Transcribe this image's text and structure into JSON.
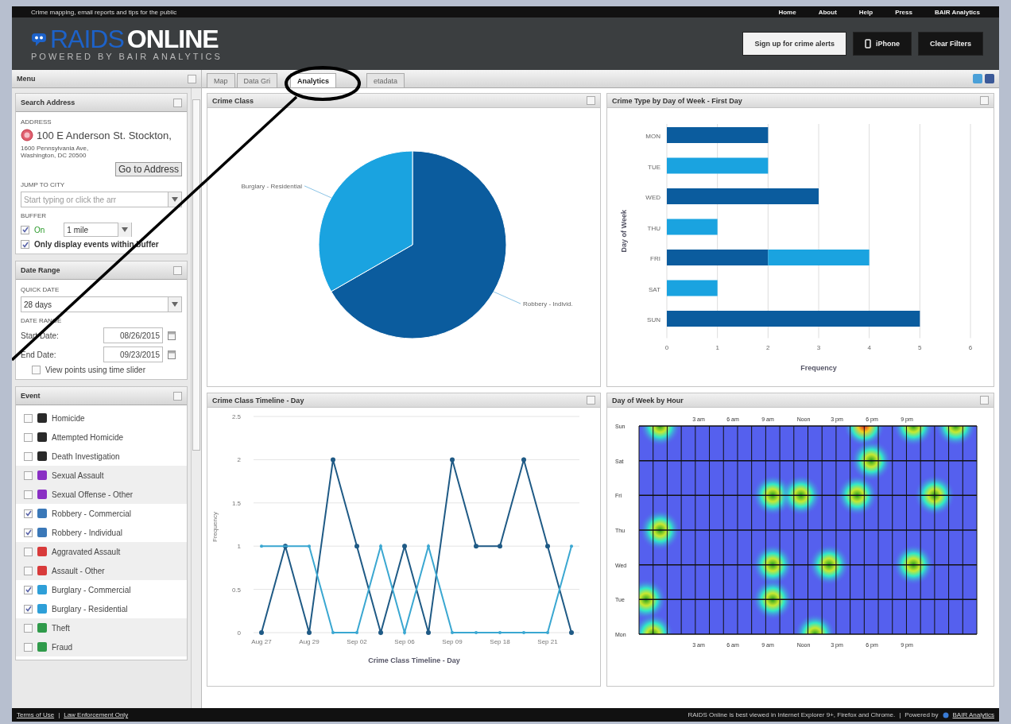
{
  "top_bar": {
    "tagline": "Crime mapping, email reports and tips for the public",
    "nav": [
      "Home",
      "About",
      "Help",
      "Press",
      "BAIR Analytics"
    ]
  },
  "header": {
    "logo_word_a": "RAIDS",
    "logo_word_b": "ONLINE",
    "logo_tagline": "POWERED BY BAIR ANALYTICS",
    "buttons": [
      {
        "label": "Sign up for crime alerts",
        "kind": "light"
      },
      {
        "label": "iPhone",
        "kind": "phone"
      },
      {
        "label": "Clear Filters",
        "kind": "dark"
      }
    ]
  },
  "sidebar": {
    "title": "Menu",
    "search": {
      "title": "Search Address",
      "address_label": "ADDRESS",
      "address_value": "100 E Anderson St. Stockton,",
      "address_example": "1600 Pennsylvania Ave, Washington, DC 20500",
      "go_button": "Go to Address",
      "city_label": "JUMP TO CITY",
      "city_placeholder": "Start typing or click the arr",
      "buffer_label": "BUFFER",
      "buffer_on": {
        "label": "On",
        "checked": true
      },
      "buffer_distance": "1 mile",
      "buffer_only": {
        "label": "Only display events within buffer",
        "checked": true
      }
    },
    "dates": {
      "title": "Date Range",
      "quick_label": "QUICK DATE",
      "quick_value": "28 days",
      "range_label": "DATE RANGE",
      "start_label": "Start Date:",
      "start_value": "08/26/2015",
      "end_label": "End Date:",
      "end_value": "09/23/2015",
      "slider_option": {
        "label": "View points using time slider",
        "checked": false
      }
    },
    "events": {
      "title": "Event",
      "items": [
        {
          "label": "Homicide",
          "checked": false,
          "color": "#2a2a2a"
        },
        {
          "label": "Attempted Homicide",
          "checked": false,
          "color": "#2a2a2a"
        },
        {
          "label": "Death Investigation",
          "checked": false,
          "color": "#2a2a2a"
        },
        {
          "label": "Sexual Assault",
          "checked": false,
          "color": "#8a2fc4"
        },
        {
          "label": "Sexual Offense - Other",
          "checked": false,
          "color": "#8a2fc4"
        },
        {
          "label": "Robbery - Commercial",
          "checked": true,
          "color": "#3a78b8"
        },
        {
          "label": "Robbery - Individual",
          "checked": true,
          "color": "#3a78b8"
        },
        {
          "label": "Aggravated Assault",
          "checked": false,
          "color": "#d83a3a"
        },
        {
          "label": "Assault - Other",
          "checked": false,
          "color": "#d83a3a"
        },
        {
          "label": "Burglary - Commercial",
          "checked": true,
          "color": "#2e9fd8"
        },
        {
          "label": "Burglary - Residential",
          "checked": true,
          "color": "#2e9fd8"
        },
        {
          "label": "Theft",
          "checked": false,
          "color": "#2f9a4a"
        },
        {
          "label": "Fraud",
          "checked": false,
          "color": "#2f9a4a"
        }
      ]
    }
  },
  "tabs": [
    {
      "label": "Map",
      "selected": false
    },
    {
      "label": "Data Gri",
      "selected": false
    },
    {
      "label": "Analytics",
      "selected": true
    },
    {
      "label": "etadata",
      "selected": false
    }
  ],
  "panels": [
    {
      "title": "Crime Class",
      "chart_data": {
        "type": "pie",
        "categories": [
          "Robbery - Individ.",
          "Burglary - Residential"
        ],
        "colors": [
          "#0b5c9e",
          "#1aa3e0"
        ],
        "values": [
          66.7,
          33.3
        ]
      }
    },
    {
      "title": "Crime Type by Day of Week - First Day",
      "chart_data": {
        "type": "bar",
        "orientation": "horizontal",
        "stacked": true,
        "grid": true,
        "xlabel": "Frequency",
        "ylabel": "Day of Week",
        "categories": [
          "MON",
          "TUE",
          "WED",
          "THU",
          "FRI",
          "SAT",
          "SUN"
        ],
        "series": [
          {
            "color": "#0b5c9e",
            "values": [
              2,
              0,
              3,
              0,
              2,
              0,
              5
            ]
          },
          {
            "color": "#1aa3e0",
            "values": [
              0,
              2,
              0,
              1,
              2,
              1,
              0
            ]
          }
        ],
        "xlim": [
          0,
          6
        ],
        "xticks": [
          0,
          1,
          2,
          3,
          4,
          5,
          6
        ]
      }
    },
    {
      "title": "Crime Class Timeline - Day",
      "chart_data": {
        "type": "line",
        "grid": true,
        "xlabel": "Crime Class Timeline - Day",
        "ylabel": "Frequency",
        "categories": [
          "Aug 27",
          null,
          "Aug 29",
          null,
          "Sep 02",
          null,
          "Sep 06",
          null,
          "Sep 09",
          null,
          "Sep 18",
          null,
          "Sep 21",
          null
        ],
        "series": [
          {
            "color": "#1f5a85",
            "marker": true,
            "values": [
              0,
              1,
              0,
              2,
              1,
              0,
              1,
              0,
              2,
              1,
              1,
              2,
              1,
              0
            ]
          },
          {
            "color": "#3aa7d1",
            "marker": true,
            "values": [
              1,
              1,
              1,
              0,
              0,
              1,
              0,
              1,
              0,
              0,
              0,
              0,
              0,
              1
            ]
          }
        ],
        "ylim": [
          0,
          2.5
        ],
        "yticks": [
          0,
          0.5,
          1,
          1.5,
          2,
          2.5
        ]
      }
    },
    {
      "kind": "heatmap",
      "title": "Day of Week by Hour",
      "days": [
        "Sun",
        "Sat",
        "Fri",
        "Thu",
        "Wed",
        "Tue",
        "Mon"
      ],
      "hours_top": [
        "3 am",
        "6 am",
        "9 am",
        "Noon",
        "3 pm",
        "6 pm",
        "9 pm"
      ],
      "hours_bottom": [
        "3 am",
        "6 am",
        "9 am",
        "Noon",
        "3 pm",
        "6 pm",
        "9 pm"
      ]
    }
  ],
  "footer": {
    "links": [
      "Terms of Use",
      "Law Enforcement Only"
    ],
    "link_separator": "|",
    "note_separator": "|",
    "note": "RAIDS Online is best viewed in Internet Explorer 9+, Firefox and Chrome.",
    "powered_label": "Powered by",
    "powered_link": "BAIR Analytics"
  }
}
